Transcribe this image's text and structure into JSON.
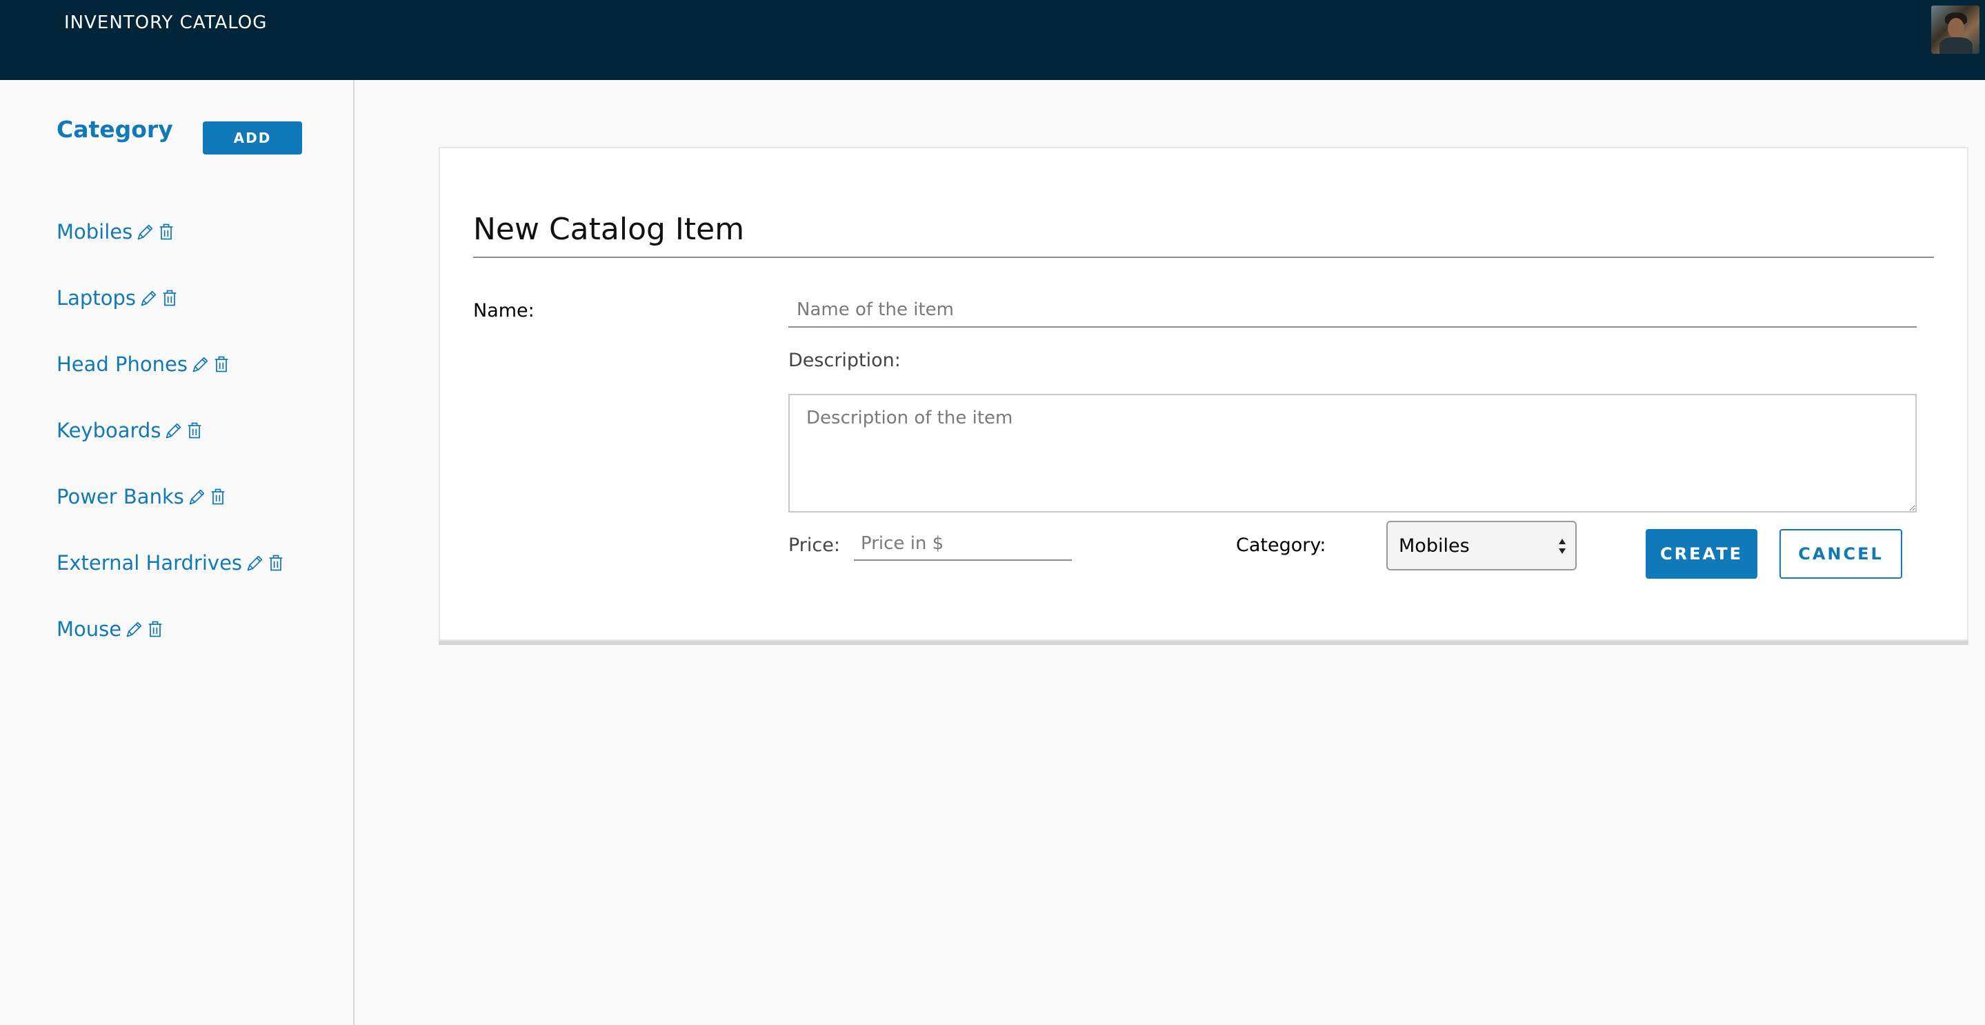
{
  "header": {
    "title": "INVENTORY CATALOG",
    "avatar_icon": "user-avatar"
  },
  "sidebar": {
    "heading": "Category",
    "add_label": "ADD",
    "items": [
      {
        "label": "Mobiles"
      },
      {
        "label": "Laptops"
      },
      {
        "label": "Head Phones"
      },
      {
        "label": "Keyboards"
      },
      {
        "label": "Power Banks"
      },
      {
        "label": "External Hardrives"
      },
      {
        "label": "Mouse"
      }
    ],
    "edit_icon": "pencil-icon",
    "delete_icon": "trash-icon"
  },
  "form": {
    "title": "New Catalog Item",
    "name_label": "Name:",
    "name_placeholder": "Name of the item",
    "description_label": "Description:",
    "description_placeholder": "Description of the item",
    "price_label": "Price:",
    "price_placeholder": "Price in $",
    "category_label": "Category:",
    "category_selected": "Mobiles",
    "create_label": "CREATE",
    "cancel_label": "CANCEL"
  },
  "colors": {
    "header_bg": "#002538",
    "accent": "#0f79b9",
    "link": "#1279b8"
  }
}
